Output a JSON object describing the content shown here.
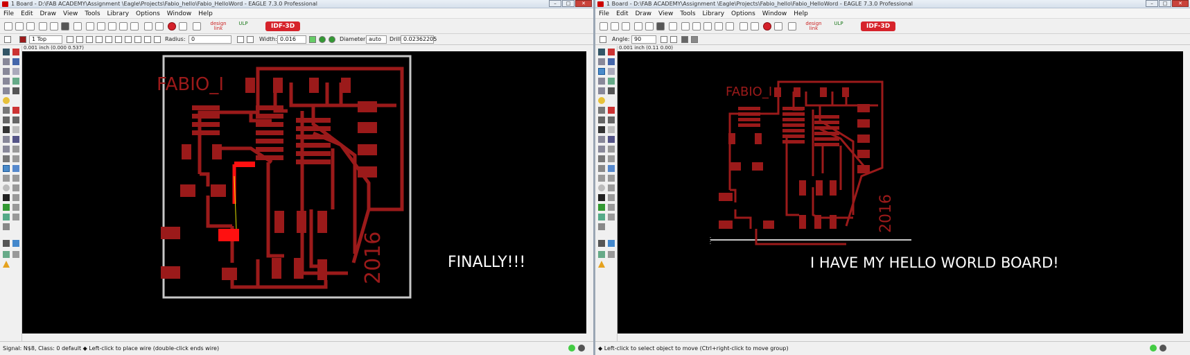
{
  "left_window": {
    "title": "1 Board - D:\\FAB ACADEMY\\Assignment \\Eagle\\Projects\\Fabio_hello\\Fabio_HelloWord - EAGLE 7.3.0 Professional",
    "menu": [
      "File",
      "Edit",
      "Draw",
      "View",
      "Tools",
      "Library",
      "Options",
      "Window",
      "Help"
    ],
    "toolbar_logos": {
      "design_link": "design link",
      "ulp": "ULP",
      "idf": "IDF-3D"
    },
    "options": {
      "layer": "1 Top",
      "radius_label": "Radius:",
      "radius_value": "0",
      "width_label": "Width:",
      "width_value": "0.016",
      "diameter_label": "Diameter:",
      "diameter_value": "auto",
      "drill_label": "Drill:",
      "drill_value": "0.02362205"
    },
    "coordinates": "0.001 inch (0.000 0.537)",
    "board_text_name": "FABIO_I",
    "board_text_year": "2016",
    "caption": "FINALLY!!!",
    "status": "Signal: N$8, Class: 0 default  ◆ Left-click to place wire (double-click ends wire)"
  },
  "right_window": {
    "title": "1 Board - D:\\FAB ACADEMY\\Assignment \\Eagle\\Projects\\Fabio_hello\\Fabio_HelloWord - EAGLE 7.3.0 Professional",
    "menu": [
      "File",
      "Edit",
      "Draw",
      "View",
      "Tools",
      "Library",
      "Options",
      "Window",
      "Help"
    ],
    "toolbar_logos": {
      "design_link": "design link",
      "ulp": "ULP",
      "idf": "IDF-3D"
    },
    "options": {
      "angle_label": "Angle:",
      "angle_value": "90"
    },
    "coordinates": "0.001 inch (0.11 0.00)",
    "board_text_name": "FABIO_I",
    "board_text_year": "2016",
    "caption": "I HAVE MY HELLO WORLD BOARD!",
    "status": "◆ Left-click to select object to move (Ctrl+right-click to move group)"
  },
  "colors": {
    "trace": "#9b1a1a",
    "highlight": "#ff1010",
    "canvas": "#000000",
    "outline": "#c8c8c8",
    "idf_button": "#d6232b"
  }
}
